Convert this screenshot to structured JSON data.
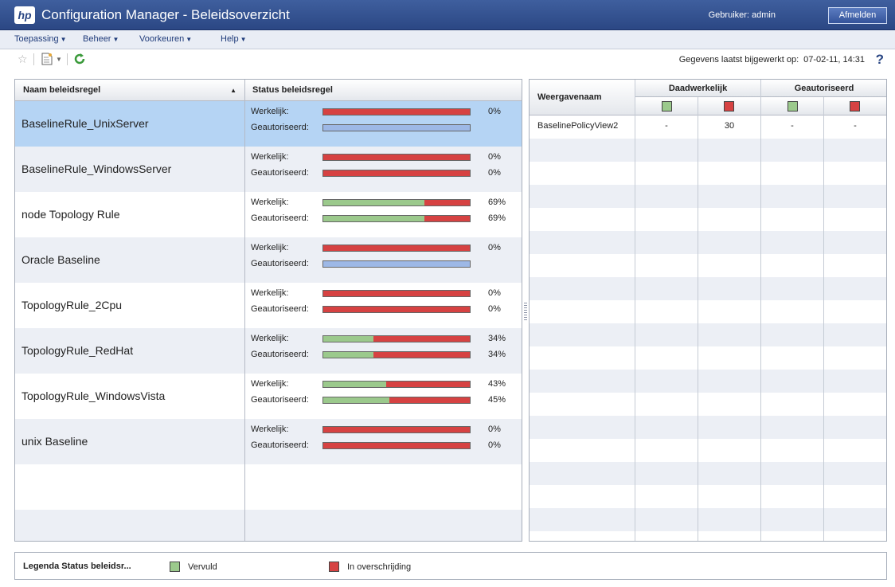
{
  "titlebar": {
    "logo": "hp",
    "title": "Configuration Manager - Beleidsoverzicht",
    "user_label": "Gebruiker: admin",
    "logout_label": "Afmelden"
  },
  "menu": [
    {
      "label": "Toepassing"
    },
    {
      "label": "Beheer"
    },
    {
      "label": "Voorkeuren"
    },
    {
      "label": "Help"
    }
  ],
  "toolbar": {
    "last_updated_label": "Gegevens laatst bijgewerkt op:",
    "last_updated_value": "07-02-11, 14:31",
    "help_glyph": "?"
  },
  "rules_table": {
    "col_name": "Naam beleidsregel",
    "col_status": "Status beleidsregel",
    "sort_indicator": "▲",
    "actual_label": "Werkelijk:",
    "authorized_label": "Geautoriseerd:",
    "rows": [
      {
        "name": "BaselineRule_UnixServer",
        "selected": true,
        "actual": {
          "fulfilled": 0,
          "text": "0%"
        },
        "authorized": {
          "fulfilled": null,
          "text": ""
        }
      },
      {
        "name": "BaselineRule_WindowsServer",
        "actual": {
          "fulfilled": 0,
          "text": "0%"
        },
        "authorized": {
          "fulfilled": 0,
          "text": "0%"
        }
      },
      {
        "name": "node Topology Rule",
        "actual": {
          "fulfilled": 69,
          "text": "69%"
        },
        "authorized": {
          "fulfilled": 69,
          "text": "69%"
        }
      },
      {
        "name": "Oracle Baseline",
        "actual": {
          "fulfilled": 0,
          "text": "0%"
        },
        "authorized": {
          "fulfilled": null,
          "text": ""
        }
      },
      {
        "name": "TopologyRule_2Cpu",
        "actual": {
          "fulfilled": 0,
          "text": "0%"
        },
        "authorized": {
          "fulfilled": 0,
          "text": "0%"
        }
      },
      {
        "name": "TopologyRule_RedHat",
        "actual": {
          "fulfilled": 34,
          "text": "34%"
        },
        "authorized": {
          "fulfilled": 34,
          "text": "34%"
        }
      },
      {
        "name": "TopologyRule_WindowsVista",
        "actual": {
          "fulfilled": 43,
          "text": "43%"
        },
        "authorized": {
          "fulfilled": 45,
          "text": "45%"
        }
      },
      {
        "name": "unix Baseline",
        "actual": {
          "fulfilled": 0,
          "text": "0%"
        },
        "authorized": {
          "fulfilled": 0,
          "text": "0%"
        }
      }
    ]
  },
  "views_table": {
    "col_view": "Weergavenaam",
    "group_actual": "Daadwerkelijk",
    "group_authorized": "Geautoriseerd",
    "rows": [
      {
        "name": "BaselinePolicyView2",
        "actual_fulfilled": "-",
        "actual_breach": "30",
        "auth_fulfilled": "-",
        "auth_breach": "-"
      }
    ]
  },
  "legend": {
    "title": "Legenda Status beleidsr...",
    "fulfilled": "Vervuld",
    "breach": "In overschrijding"
  },
  "colors": {
    "fulfilled": "#9bc98c",
    "breach": "#d64242",
    "not_set": "#9db8e6",
    "selected_row": "#b5d4f4"
  }
}
